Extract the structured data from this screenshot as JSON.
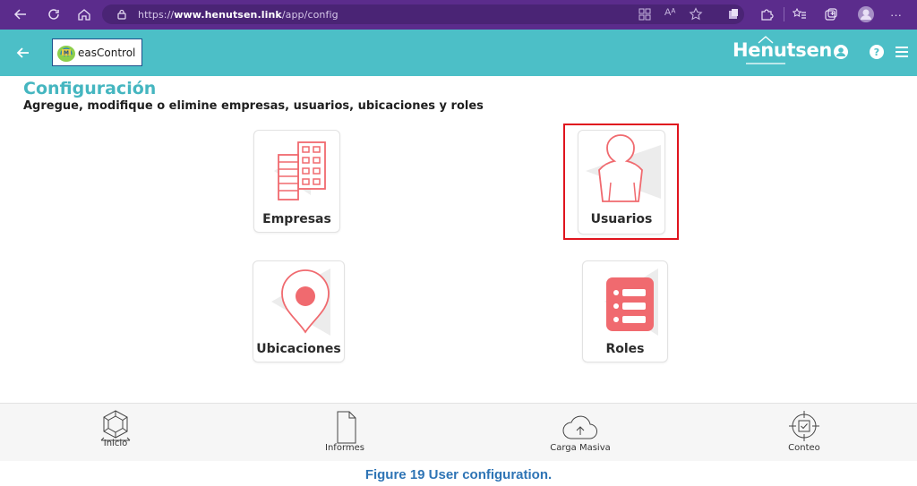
{
  "browser": {
    "url_prefix": "https://",
    "url_host": "www.henutsen.link",
    "url_path": "/app/config",
    "reader_mode_label": "Aᴬ"
  },
  "header": {
    "logo_text": "easControl",
    "brand": "Henutsen",
    "accent_color": "#4cbfc7"
  },
  "page": {
    "title": "Configuración",
    "subtitle": "Agregue, modifique o elimine empresas, usuarios,  ubicaciones y roles"
  },
  "cards": [
    {
      "label": "Empresas",
      "icon": "building-icon"
    },
    {
      "label": "Usuarios",
      "icon": "user-icon",
      "highlighted": true
    },
    {
      "label": "Ubicaciones",
      "icon": "location-pin-icon"
    },
    {
      "label": "Roles",
      "icon": "roles-list-icon"
    }
  ],
  "bottom_nav": [
    {
      "label": "Inicio",
      "icon": "home-cube-icon"
    },
    {
      "label": "Informes",
      "icon": "document-icon"
    },
    {
      "label": "Carga Masiva",
      "icon": "cloud-upload-icon"
    },
    {
      "label": "Conteo",
      "icon": "target-check-icon"
    }
  ],
  "caption": "Figure 19 User configuration.",
  "colors": {
    "icon_red": "#f06a6f",
    "title_teal": "#45b6c0",
    "highlight_red": "#e0141e"
  }
}
